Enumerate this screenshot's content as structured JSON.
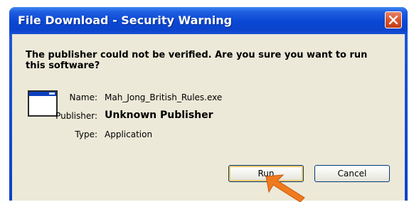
{
  "window": {
    "title": "File Download - Security Warning"
  },
  "dialog": {
    "message": "The publisher could not be verified.  Are you sure you want to run this software?",
    "fields": [
      {
        "label": "Name:",
        "value": "Mah_Jong_British_Rules.exe"
      },
      {
        "label": "Publisher:",
        "value": "Unknown Publisher"
      },
      {
        "label": "Type:",
        "value": "Application"
      }
    ]
  },
  "buttons": {
    "run": "Run",
    "cancel": "Cancel"
  },
  "icons": {
    "close": "close-icon",
    "file": "application-window-icon",
    "pointer": "orange-arrow-pointer"
  },
  "colors": {
    "titlebar": "#0a47d4",
    "client": "#ece9d8",
    "close": "#d9542f",
    "arrow": "#f07a1e"
  }
}
